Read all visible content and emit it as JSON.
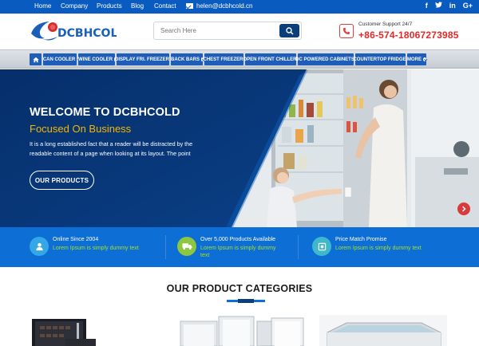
{
  "topbar": {
    "nav": [
      "Home",
      "Company",
      "Products",
      "Blog",
      "Contact"
    ],
    "email": "helen@dcbhcold.cn",
    "social_icons": [
      "facebook-icon",
      "twitter-icon",
      "linkedin-icon",
      "google-plus-icon"
    ]
  },
  "header": {
    "logo_text": "DCBHCOLD",
    "search_placeholder": "Search Here",
    "support_label": "Customer Support 24/7",
    "phone": "+86-574-18067273985"
  },
  "menu": {
    "items": [
      {
        "label": "CAN COOLER"
      },
      {
        "label": "WINE COOLER"
      },
      {
        "label": "DISPLAY FRI. FREEZER"
      },
      {
        "label": "BACK BARS"
      },
      {
        "label": "CHEST FREEZER"
      },
      {
        "label": "OPEN FRONT CHILLER"
      },
      {
        "label": "DC POWERED CABINETS"
      },
      {
        "label": "COUNTERTOP FRIDGE"
      },
      {
        "label": "MORE"
      }
    ]
  },
  "hero": {
    "title": "WELCOME TO DCBHCOLD",
    "subtitle": "Focused On Business",
    "body": "It is a long established fact that a reader will be distracted by the readable content of a page when looking at its layout. The point",
    "button": "OUR PRODUCTS"
  },
  "features": [
    {
      "title": "Online Since 2004",
      "subtitle": "Lorem Ipsum is simply dummy text",
      "icon": "user-icon"
    },
    {
      "title": "Over 5,000 Products Available",
      "subtitle": "Lorem Ipsum is simply dummy text",
      "icon": "truck-icon"
    },
    {
      "title": "Price Match Promise",
      "subtitle": "Lorem Ipsum is simply dummy text",
      "icon": "price-tag-icon"
    }
  ],
  "categories": {
    "title": "OUR PRODUCT CATEGORIES"
  },
  "colors": {
    "primary_blue": "#0d6ed6",
    "dark_navy": "#0b3f7c",
    "accent_yellow": "#f2b705",
    "accent_green": "#a6e022",
    "phone_red": "#e02a2a"
  }
}
